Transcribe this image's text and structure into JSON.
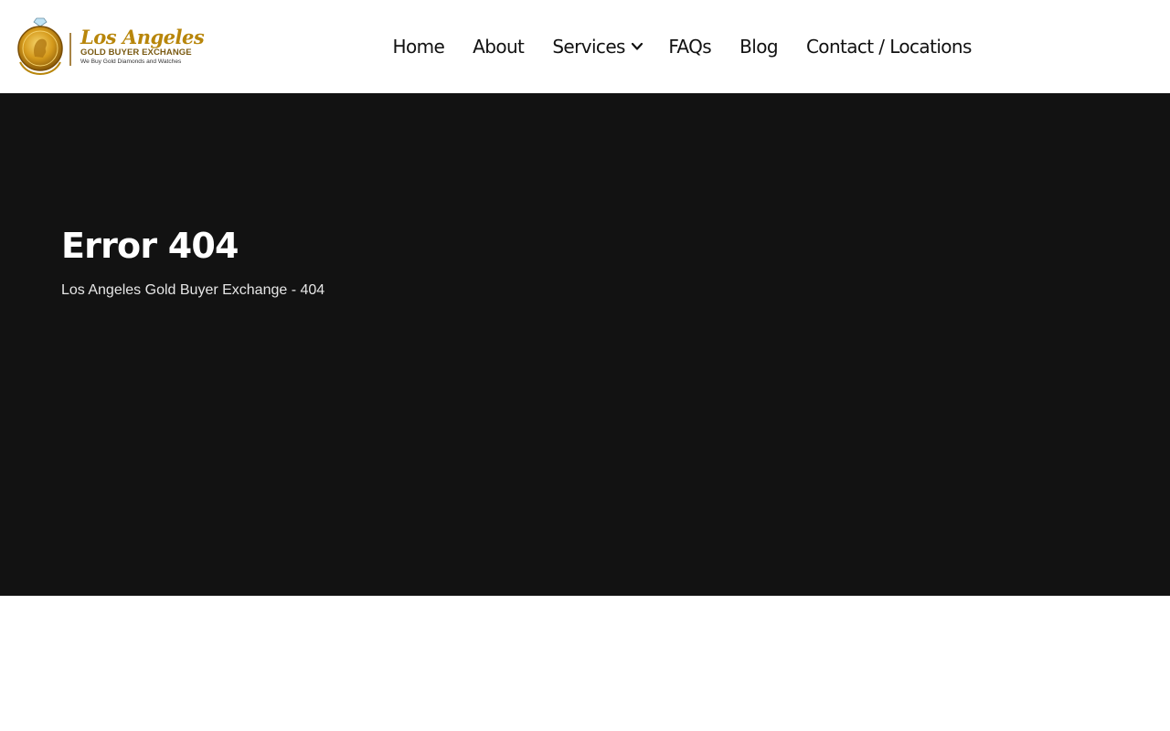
{
  "header": {
    "logo": {
      "script": "Los Angeles",
      "sub": "GOLD BUYER EXCHANGE",
      "tagline": "We Buy Gold Diamonds and Watches"
    },
    "nav": {
      "items": [
        {
          "label": "Home"
        },
        {
          "label": "About"
        },
        {
          "label": "Services",
          "has_dropdown": true
        },
        {
          "label": "FAQs"
        },
        {
          "label": "Blog"
        },
        {
          "label": "Contact / Locations"
        }
      ]
    }
  },
  "hero": {
    "title": "Error 404",
    "subtitle": "Los Angeles Gold Buyer Exchange - 404"
  },
  "colors": {
    "hero_bg": "#121212",
    "gold": "#b8860b",
    "nav_text": "#111111"
  },
  "icons": {
    "services_dropdown": "chevron-down-icon",
    "logo_emblem": "gold-coin-icon"
  }
}
